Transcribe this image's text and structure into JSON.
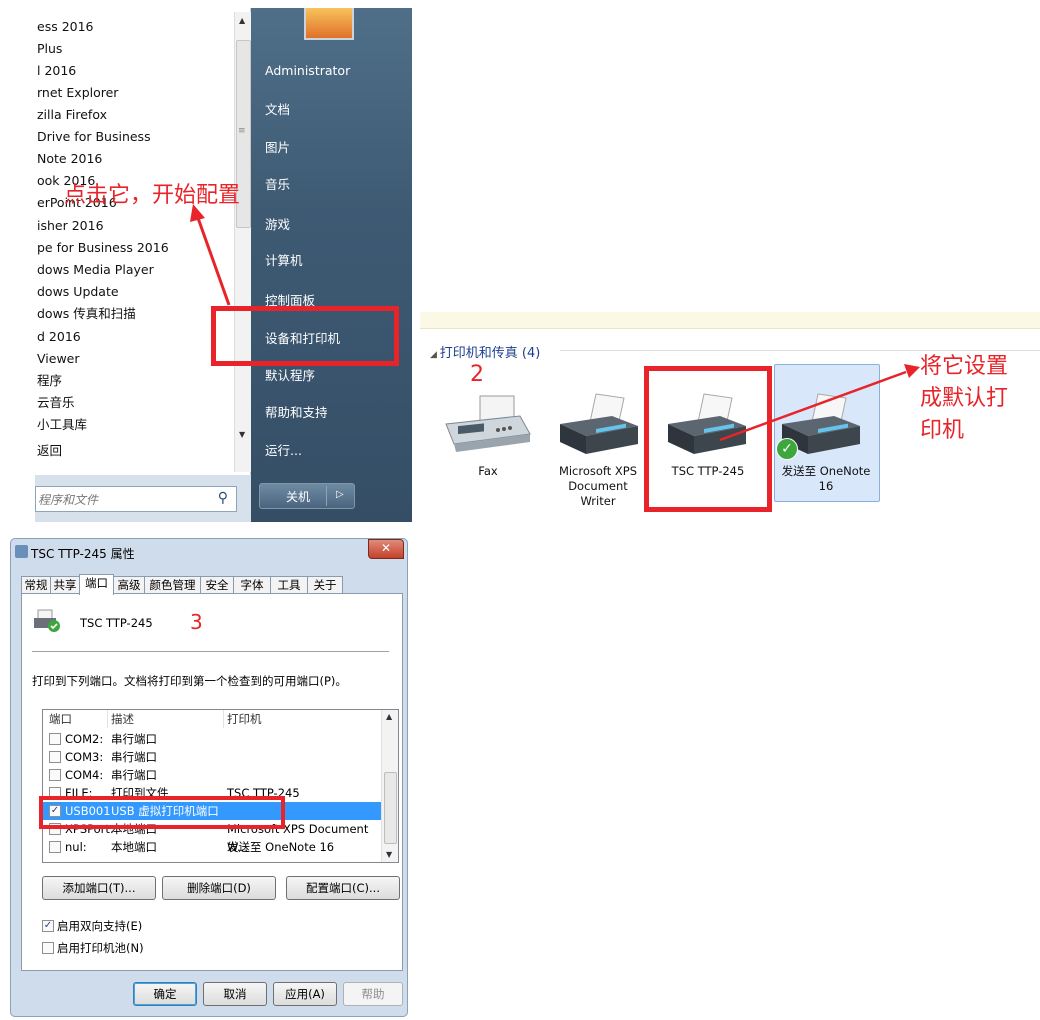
{
  "start_menu": {
    "programs": [
      "ess 2016",
      "Plus",
      "l 2016",
      "rnet Explorer",
      "zilla Firefox",
      "Drive for Business",
      "Note 2016",
      "ook 2016",
      "erPoint 2016",
      "isher 2016",
      "pe for Business 2016",
      "dows Media Player",
      "dows Update",
      "dows 传真和扫描",
      "d 2016",
      "Viewer",
      "程序",
      "云音乐",
      "小工具库",
      "返回"
    ],
    "search_placeholder": "程序和文件",
    "right_items": [
      "Administrator",
      "文档",
      "图片",
      "音乐",
      "游戏",
      "计算机",
      "控制面板",
      "设备和打印机",
      "默认程序",
      "帮助和支持",
      "运行..."
    ],
    "shutdown_label": "关机",
    "annotation": "点击它，开始配置"
  },
  "devices": {
    "group_header": "打印机和传真 (4)",
    "step_number": "2",
    "annotation_lines": [
      "将它设置",
      "成默认打",
      "印机"
    ],
    "items": [
      {
        "label": "Fax",
        "icon": "fax-icon"
      },
      {
        "label": "Microsoft XPS Document Writer",
        "icon": "printer-icon"
      },
      {
        "label": "TSC TTP-245",
        "icon": "printer-icon"
      },
      {
        "label": "发送至 OneNote 16",
        "icon": "printer-icon",
        "default": true
      }
    ]
  },
  "dialog": {
    "title": "TSC TTP-245 属性",
    "tabs": [
      "常规",
      "共享",
      "端口",
      "高级",
      "颜色管理",
      "安全",
      "字体",
      "工具",
      "关于"
    ],
    "active_tab": "端口",
    "printer_name": "TSC TTP-245",
    "step_number": "3",
    "instruction": "打印到下列端口。文档将打印到第一个检查到的可用端口(P)。",
    "columns": [
      "端口",
      "描述",
      "打印机"
    ],
    "ports": [
      {
        "port": "COM2:",
        "desc": "串行端口",
        "printer": "",
        "checked": false
      },
      {
        "port": "COM3:",
        "desc": "串行端口",
        "printer": "",
        "checked": false
      },
      {
        "port": "COM4:",
        "desc": "串行端口",
        "printer": "",
        "checked": false
      },
      {
        "port": "FILE:",
        "desc": "打印到文件",
        "printer": "TSC TTP-245",
        "checked": false
      },
      {
        "port": "USB001",
        "desc": "USB 虚拟打印机端口",
        "printer": "",
        "checked": true,
        "selected": true
      },
      {
        "port": "XPSPort:",
        "desc": "本地端口",
        "printer": "Microsoft XPS Document W...",
        "checked": false
      },
      {
        "port": "nul:",
        "desc": "本地端口",
        "printer": "发送至 OneNote 16",
        "checked": false
      }
    ],
    "add_port": "添加端口(T)...",
    "delete_port": "删除端口(D)",
    "config_port": "配置端口(C)...",
    "bidi_support": "启用双向支持(E)",
    "bidi_checked": true,
    "pooling": "启用打印机池(N)",
    "pooling_checked": false,
    "ok": "确定",
    "cancel": "取消",
    "apply": "应用(A)",
    "help": "帮助"
  },
  "colors": {
    "annotation_red": "#e8242a",
    "selection_blue": "#3399ff",
    "link_blue": "#1e3f8f"
  }
}
